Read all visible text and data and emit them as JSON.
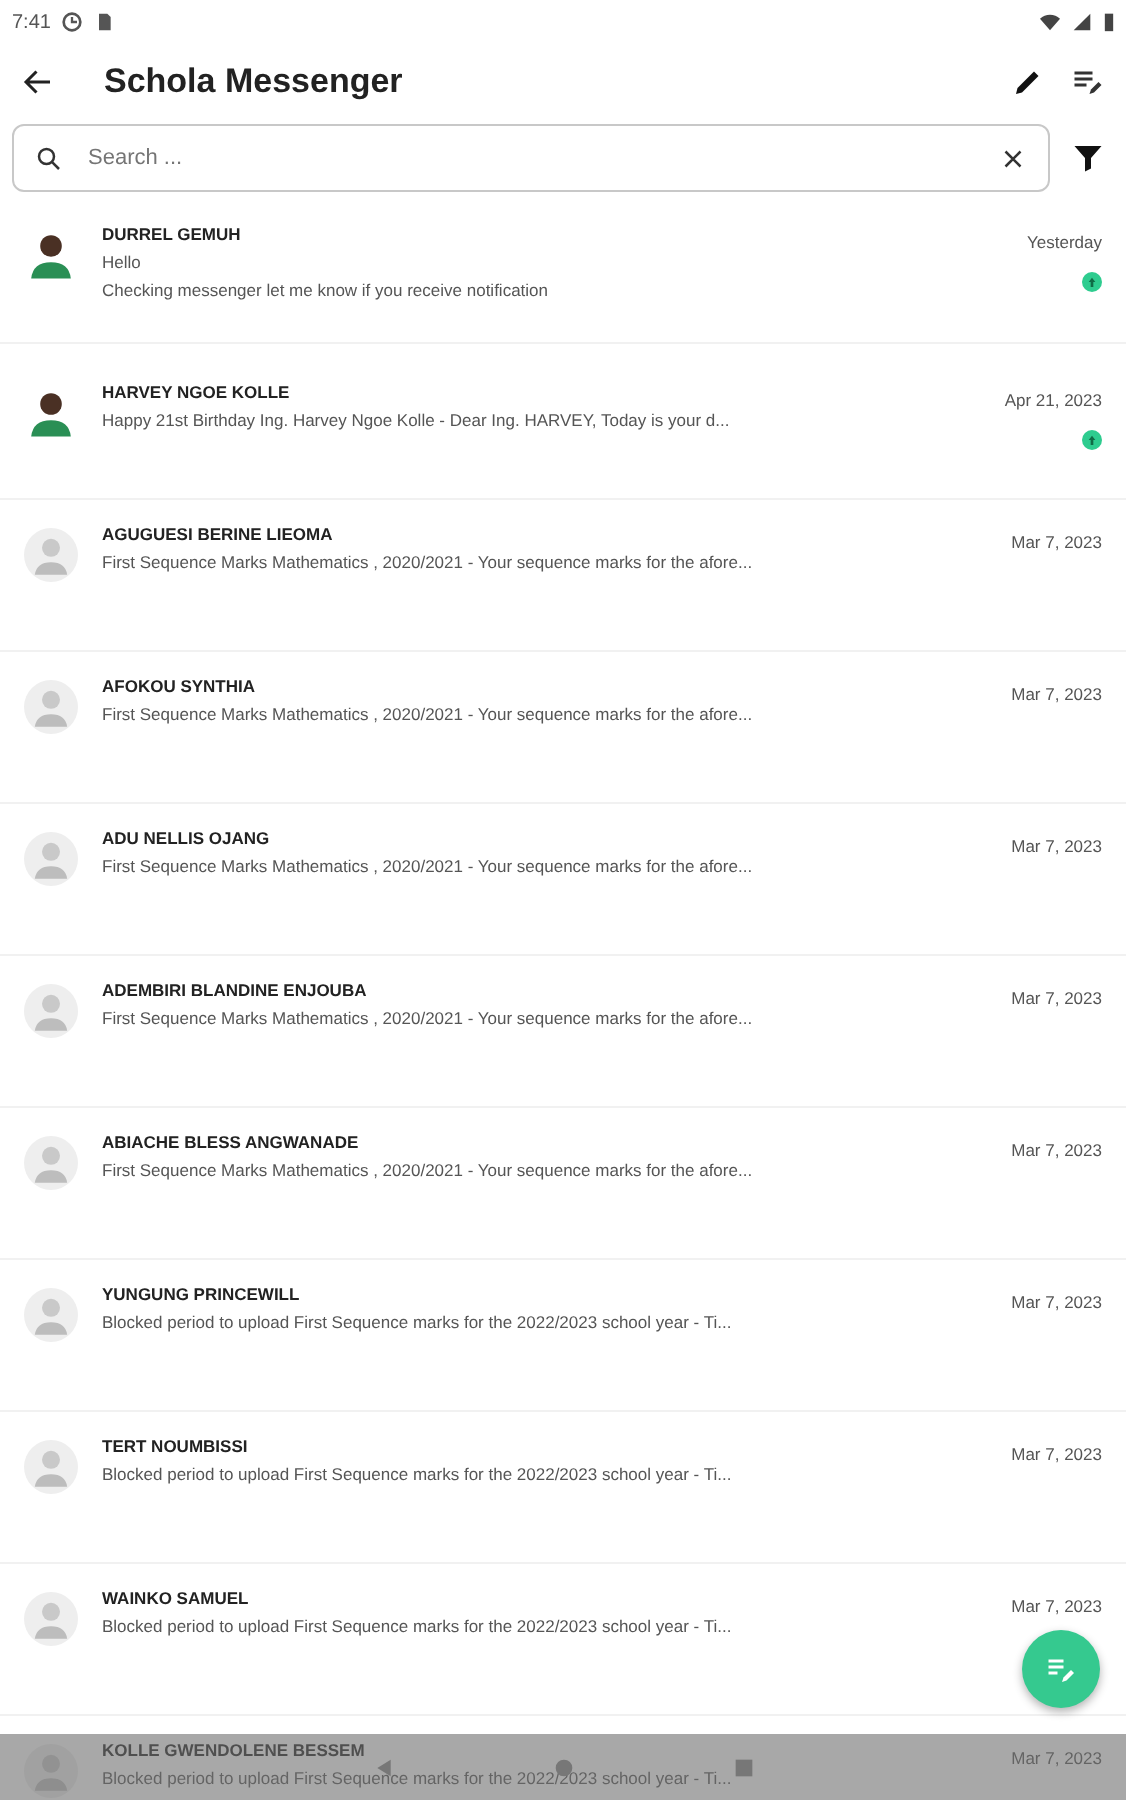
{
  "status_bar": {
    "time": "7:41"
  },
  "app_bar": {
    "title": "Schola Messenger"
  },
  "search": {
    "placeholder": "Search ..."
  },
  "conversations": [
    {
      "name": "DURREL GEMUH",
      "kind": "photo",
      "lines": [
        "Hello",
        "Checking messenger let me know if you receive notification"
      ],
      "date": "Yesterday",
      "unread": true
    },
    {
      "name": "HARVEY NGOE KOLLE",
      "kind": "photo",
      "lines": [
        "Happy 21st Birthday Ing. Harvey Ngoe Kolle -  Dear Ing. HARVEY,  Today is your d..."
      ],
      "date": "Apr 21, 2023",
      "unread": true
    },
    {
      "name": "AGUGUESI BERINE LIEOMA",
      "kind": "default",
      "lines": [
        "First Sequence Marks Mathematics , 2020/2021 - Your sequence marks for the afore..."
      ],
      "date": "Mar 7, 2023",
      "unread": false
    },
    {
      "name": "AFOKOU SYNTHIA",
      "kind": "default",
      "lines": [
        "First Sequence Marks Mathematics , 2020/2021 - Your sequence marks for the afore..."
      ],
      "date": "Mar 7, 2023",
      "unread": false
    },
    {
      "name": "ADU NELLIS OJANG",
      "kind": "default",
      "lines": [
        "First Sequence Marks Mathematics , 2020/2021 - Your sequence marks for the afore..."
      ],
      "date": "Mar 7, 2023",
      "unread": false
    },
    {
      "name": "ADEMBIRI BLANDINE ENJOUBA",
      "kind": "default",
      "lines": [
        "First Sequence Marks Mathematics , 2020/2021 - Your sequence marks for the afore..."
      ],
      "date": "Mar 7, 2023",
      "unread": false
    },
    {
      "name": "ABIACHE BLESS ANGWANADE",
      "kind": "default",
      "lines": [
        "First Sequence Marks Mathematics , 2020/2021 - Your sequence marks for the afore..."
      ],
      "date": "Mar 7, 2023",
      "unread": false
    },
    {
      "name": "YUNGUNG PRINCEWILL",
      "kind": "default",
      "lines": [
        "Blocked period to upload First Sequence marks for the 2022/2023 school year - Ti..."
      ],
      "date": "Mar 7, 2023",
      "unread": false
    },
    {
      "name": "TERT NOUMBISSI",
      "kind": "default",
      "lines": [
        "Blocked period to upload First Sequence marks for the 2022/2023 school year - Ti..."
      ],
      "date": "Mar 7, 2023",
      "unread": false
    },
    {
      "name": "WAINKO SAMUEL",
      "kind": "default",
      "lines": [
        "Blocked period to upload First Sequence marks for the 2022/2023 school year - Ti..."
      ],
      "date": "Mar 7, 2023",
      "unread": false
    },
    {
      "name": "KOLLE GWENDOLENE BESSEM",
      "kind": "default",
      "lines": [
        "Blocked period to upload First Sequence marks for the 2022/2023 school year - Ti..."
      ],
      "date": "Mar 7, 2023",
      "unread": false
    }
  ]
}
